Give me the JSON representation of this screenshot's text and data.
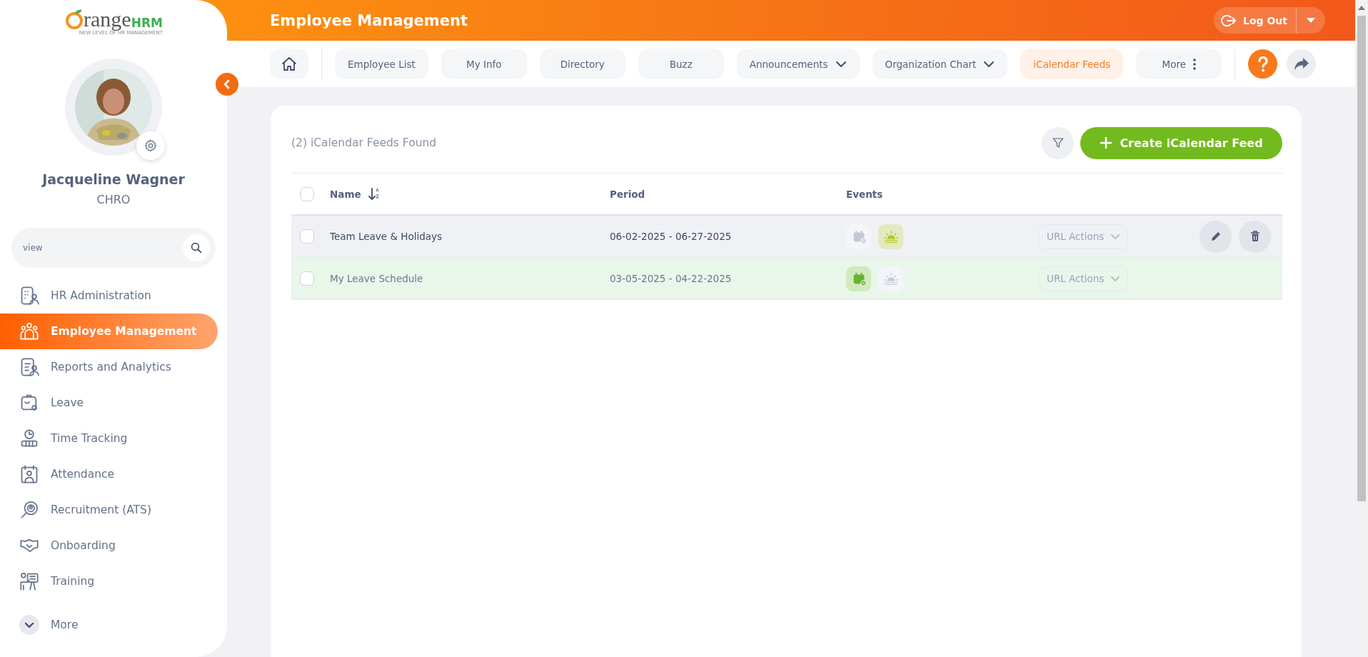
{
  "logo": {
    "wordmark": "range",
    "suffix": "HRM",
    "tagline": "NEW LEVEL OF HR MANAGEMENT"
  },
  "profile": {
    "name": "Jacqueline Wagner",
    "role": "CHRO"
  },
  "search": {
    "value": "view"
  },
  "menu": [
    {
      "label": "HR Administration",
      "kind": "module",
      "selected": false
    },
    {
      "label": "Employee Management",
      "kind": "module",
      "selected": true
    },
    {
      "label": "Reports and Analytics",
      "kind": "module",
      "selected": false
    },
    {
      "label": "Leave",
      "kind": "module",
      "selected": false
    },
    {
      "label": "Time Tracking",
      "kind": "module",
      "selected": false
    },
    {
      "label": "Attendance",
      "kind": "module",
      "selected": false
    },
    {
      "label": "Recruitment (ATS)",
      "kind": "module",
      "selected": false
    },
    {
      "label": "Onboarding",
      "kind": "module",
      "selected": false
    },
    {
      "label": "Training",
      "kind": "module",
      "selected": false
    },
    {
      "label": "More",
      "kind": "more",
      "selected": false
    }
  ],
  "header": {
    "title": "Employee Management",
    "logout": "Log Out"
  },
  "tabs": [
    {
      "label": "Employee List",
      "kind": "plain",
      "selected": false
    },
    {
      "label": "My Info",
      "kind": "plain",
      "selected": false
    },
    {
      "label": "Directory",
      "kind": "plain",
      "selected": false
    },
    {
      "label": "Buzz",
      "kind": "plain",
      "selected": false
    },
    {
      "label": "Announcements",
      "kind": "dropdown",
      "selected": false
    },
    {
      "label": "Organization Chart",
      "kind": "dropdown",
      "selected": false
    },
    {
      "label": "iCalendar Feeds",
      "kind": "plain",
      "selected": true
    },
    {
      "label": "More",
      "kind": "more",
      "selected": false
    }
  ],
  "list": {
    "count_text": "(2) iCalendar Feeds Found",
    "create_button": "Create iCalendar Feed",
    "columns": [
      {
        "label": "Name",
        "sorted": true
      },
      {
        "label": "Period",
        "sorted": false
      },
      {
        "label": "Events",
        "sorted": false
      }
    ],
    "all_checked": false,
    "rows": [
      {
        "checked": false,
        "name": "Team Leave & Holidays",
        "period": "06-02-2025 - 06-27-2025",
        "events": [
          {
            "kind": "leave",
            "on": false
          },
          {
            "kind": "holiday",
            "on": true
          }
        ],
        "url_actions": "URL Actions",
        "hovered": true,
        "highlighted": false
      },
      {
        "checked": false,
        "name": "My Leave Schedule",
        "period": "03-05-2025 - 04-22-2025",
        "events": [
          {
            "kind": "leave",
            "on": true
          },
          {
            "kind": "holiday",
            "on": false
          }
        ],
        "url_actions": "URL Actions",
        "hovered": false,
        "highlighted": true
      }
    ]
  }
}
